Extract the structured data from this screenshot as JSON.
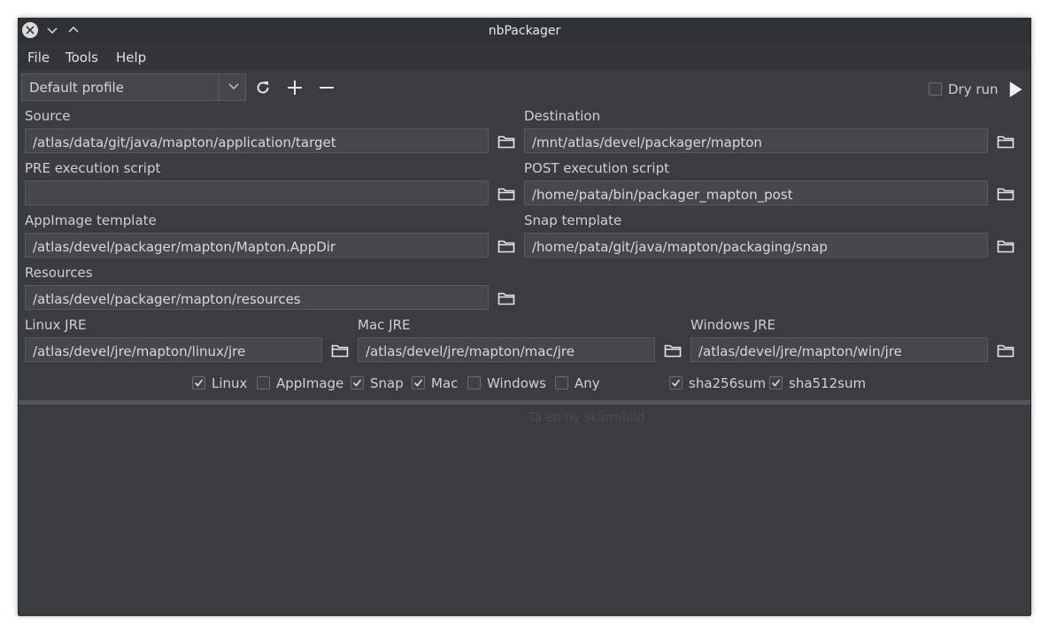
{
  "window": {
    "title": "nbPackager"
  },
  "menu": [
    "File",
    "Tools",
    "Help"
  ],
  "toolbar": {
    "profile": "Default profile",
    "dry_run_label": "Dry run",
    "dry_run_checked": false
  },
  "fields": {
    "source": {
      "label": "Source",
      "value": "/atlas/data/git/java/mapton/application/target"
    },
    "destination": {
      "label": "Destination",
      "value": "/mnt/atlas/devel/packager/mapton"
    },
    "pre": {
      "label": "PRE execution script",
      "value": ""
    },
    "post": {
      "label": "POST execution script",
      "value": "/home/pata/bin/packager_mapton_post"
    },
    "appimage": {
      "label": "AppImage template",
      "value": "/atlas/devel/packager/mapton/Mapton.AppDir"
    },
    "snap": {
      "label": "Snap template",
      "value": "/home/pata/git/java/mapton/packaging/snap"
    },
    "resources": {
      "label": "Resources",
      "value": "/atlas/devel/packager/mapton/resources"
    },
    "linux_jre": {
      "label": "Linux JRE",
      "value": "/atlas/devel/jre/mapton/linux/jre"
    },
    "mac_jre": {
      "label": "Mac JRE",
      "value": "/atlas/devel/jre/mapton/mac/jre"
    },
    "win_jre": {
      "label": "Windows JRE",
      "value": "/atlas/devel/jre/mapton/win/jre"
    }
  },
  "targets": [
    {
      "label": "Linux",
      "checked": true
    },
    {
      "label": "AppImage",
      "checked": false
    },
    {
      "label": "Snap",
      "checked": true
    },
    {
      "label": "Mac",
      "checked": true
    },
    {
      "label": "Windows",
      "checked": false
    },
    {
      "label": "Any",
      "checked": false
    },
    {
      "label": "sha256sum",
      "checked": true
    },
    {
      "label": "sha512sum",
      "checked": true
    }
  ],
  "overlay_text": "Ta en ny skärmbild",
  "colors": {
    "background": "#3a3d40",
    "accent": "#5b8ad1"
  }
}
